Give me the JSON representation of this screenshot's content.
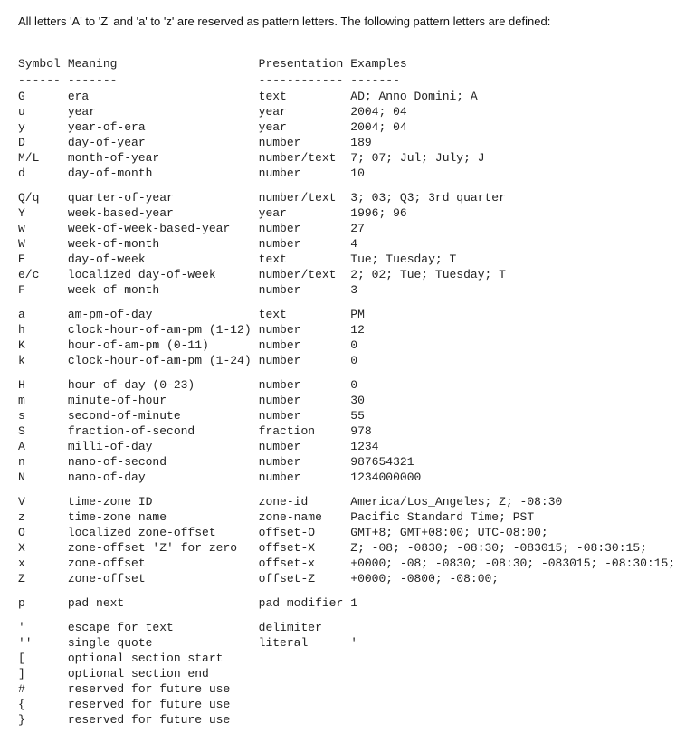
{
  "intro": "All letters 'A' to 'Z' and 'a' to 'z' are reserved as pattern letters. The following pattern letters are defined:",
  "headers": {
    "symbol": "Symbol",
    "meaning": "Meaning",
    "presentation": "Presentation",
    "examples": "Examples"
  },
  "dividers": {
    "symbol": "------",
    "meaning": "-------",
    "presentation": "------------",
    "examples": "-------"
  },
  "rows": [
    {
      "symbol": "G",
      "meaning": "era",
      "presentation": "text",
      "examples": "AD; Anno Domini; A"
    },
    {
      "symbol": "u",
      "meaning": "year",
      "presentation": "year",
      "examples": "2004; 04"
    },
    {
      "symbol": "y",
      "meaning": "year-of-era",
      "presentation": "year",
      "examples": "2004; 04"
    },
    {
      "symbol": "D",
      "meaning": "day-of-year",
      "presentation": "number",
      "examples": "189"
    },
    {
      "symbol": "M/L",
      "meaning": "month-of-year",
      "presentation": "number/text",
      "examples": "7; 07; Jul; July; J"
    },
    {
      "symbol": "d",
      "meaning": "day-of-month",
      "presentation": "number",
      "examples": "10"
    },
    {
      "symbol": "",
      "meaning": "",
      "presentation": "",
      "examples": "",
      "spacer": true
    },
    {
      "symbol": "Q/q",
      "meaning": "quarter-of-year",
      "presentation": "number/text",
      "examples": "3; 03; Q3; 3rd quarter"
    },
    {
      "symbol": "Y",
      "meaning": "week-based-year",
      "presentation": "year",
      "examples": "1996; 96"
    },
    {
      "symbol": "w",
      "meaning": "week-of-week-based-year",
      "presentation": "number",
      "examples": "27"
    },
    {
      "symbol": "W",
      "meaning": "week-of-month",
      "presentation": "number",
      "examples": "4"
    },
    {
      "symbol": "E",
      "meaning": "day-of-week",
      "presentation": "text",
      "examples": "Tue; Tuesday; T"
    },
    {
      "symbol": "e/c",
      "meaning": "localized day-of-week",
      "presentation": "number/text",
      "examples": "2; 02; Tue; Tuesday; T"
    },
    {
      "symbol": "F",
      "meaning": "week-of-month",
      "presentation": "number",
      "examples": "3"
    },
    {
      "symbol": "",
      "meaning": "",
      "presentation": "",
      "examples": "",
      "spacer": true
    },
    {
      "symbol": "a",
      "meaning": "am-pm-of-day",
      "presentation": "text",
      "examples": "PM"
    },
    {
      "symbol": "h",
      "meaning": "clock-hour-of-am-pm (1-12)",
      "presentation": "number",
      "examples": "12"
    },
    {
      "symbol": "K",
      "meaning": "hour-of-am-pm (0-11)",
      "presentation": "number",
      "examples": "0"
    },
    {
      "symbol": "k",
      "meaning": "clock-hour-of-am-pm (1-24)",
      "presentation": "number",
      "examples": "0"
    },
    {
      "symbol": "",
      "meaning": "",
      "presentation": "",
      "examples": "",
      "spacer": true
    },
    {
      "symbol": "H",
      "meaning": "hour-of-day (0-23)",
      "presentation": "number",
      "examples": "0"
    },
    {
      "symbol": "m",
      "meaning": "minute-of-hour",
      "presentation": "number",
      "examples": "30"
    },
    {
      "symbol": "s",
      "meaning": "second-of-minute",
      "presentation": "number",
      "examples": "55"
    },
    {
      "symbol": "S",
      "meaning": "fraction-of-second",
      "presentation": "fraction",
      "examples": "978"
    },
    {
      "symbol": "A",
      "meaning": "milli-of-day",
      "presentation": "number",
      "examples": "1234"
    },
    {
      "symbol": "n",
      "meaning": "nano-of-second",
      "presentation": "number",
      "examples": "987654321"
    },
    {
      "symbol": "N",
      "meaning": "nano-of-day",
      "presentation": "number",
      "examples": "1234000000"
    },
    {
      "symbol": "",
      "meaning": "",
      "presentation": "",
      "examples": "",
      "spacer": true
    },
    {
      "symbol": "V",
      "meaning": "time-zone ID",
      "presentation": "zone-id",
      "examples": "America/Los_Angeles; Z; -08:30"
    },
    {
      "symbol": "z",
      "meaning": "time-zone name",
      "presentation": "zone-name",
      "examples": "Pacific Standard Time; PST"
    },
    {
      "symbol": "O",
      "meaning": "localized zone-offset",
      "presentation": "offset-O",
      "examples": "GMT+8; GMT+08:00; UTC-08:00;"
    },
    {
      "symbol": "X",
      "meaning": "zone-offset 'Z' for zero",
      "presentation": "offset-X",
      "examples": "Z; -08; -0830; -08:30; -083015; -08:30:15;"
    },
    {
      "symbol": "x",
      "meaning": "zone-offset",
      "presentation": "offset-x",
      "examples": "+0000; -08; -0830; -08:30; -083015; -08:30:15;"
    },
    {
      "symbol": "Z",
      "meaning": "zone-offset",
      "presentation": "offset-Z",
      "examples": "+0000; -0800; -08:00;"
    },
    {
      "symbol": "",
      "meaning": "",
      "presentation": "",
      "examples": "",
      "spacer": true
    },
    {
      "symbol": "p",
      "meaning": "pad next",
      "presentation": "pad modifier",
      "examples": "1"
    },
    {
      "symbol": "",
      "meaning": "",
      "presentation": "",
      "examples": "",
      "spacer": true
    },
    {
      "symbol": "'",
      "meaning": "escape for text",
      "presentation": "delimiter",
      "examples": ""
    },
    {
      "symbol": "''",
      "meaning": "single quote",
      "presentation": "literal",
      "examples": "'"
    },
    {
      "symbol": "[",
      "meaning": "optional section start",
      "presentation": "",
      "examples": ""
    },
    {
      "symbol": "]",
      "meaning": "optional section end",
      "presentation": "",
      "examples": ""
    },
    {
      "symbol": "#",
      "meaning": "reserved for future use",
      "presentation": "",
      "examples": ""
    },
    {
      "symbol": "{",
      "meaning": "reserved for future use",
      "presentation": "",
      "examples": ""
    },
    {
      "symbol": "}",
      "meaning": "reserved for future use",
      "presentation": "",
      "examples": ""
    }
  ]
}
